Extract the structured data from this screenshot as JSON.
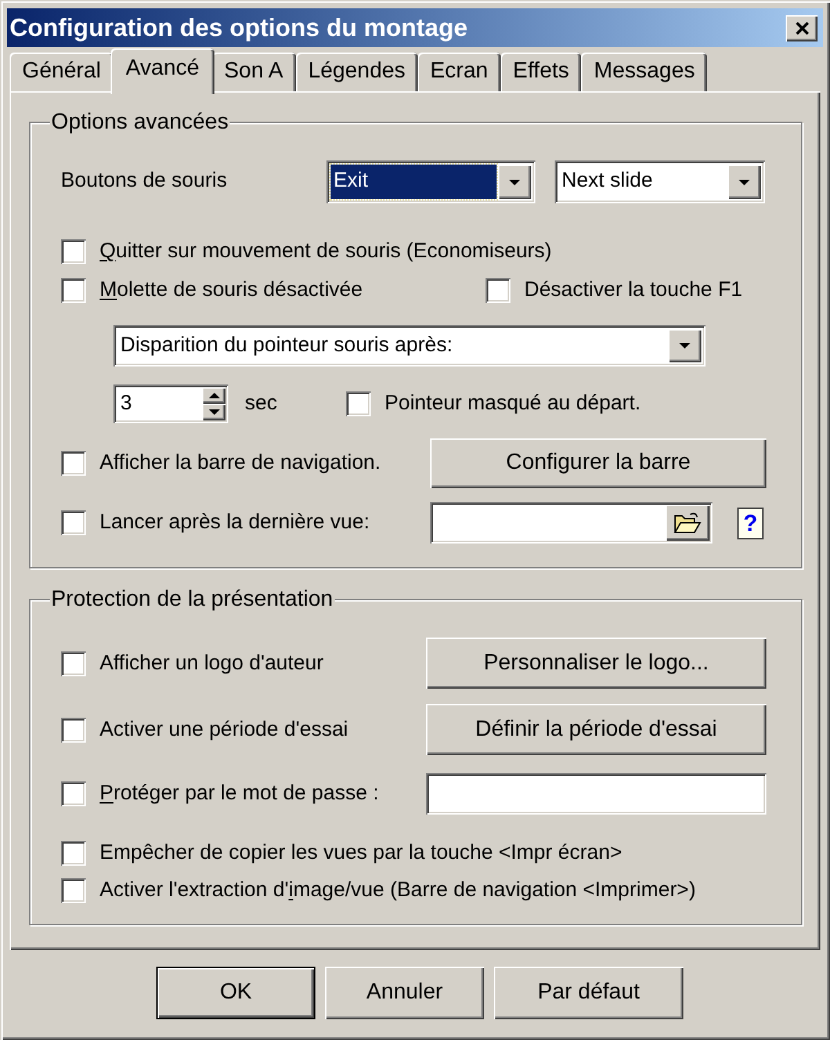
{
  "window": {
    "title": "Configuration des options du montage"
  },
  "tabs": [
    {
      "label": "Général",
      "selected": false
    },
    {
      "label": "Avancé",
      "selected": true
    },
    {
      "label": "Son A",
      "selected": false
    },
    {
      "label": "Légendes",
      "selected": false
    },
    {
      "label": "Ecran",
      "selected": false
    },
    {
      "label": "Effets",
      "selected": false
    },
    {
      "label": "Messages",
      "selected": false
    }
  ],
  "advanced": {
    "legend": "Options avancées",
    "mouse_buttons": {
      "label": "Boutons de souris",
      "combos": [
        {
          "value": "Exit",
          "focused": true
        },
        {
          "value": "Next slide",
          "focused": false
        }
      ]
    },
    "quit_on_mouse_move": {
      "access_key": "Q",
      "label_rest": "uitter sur mouvement de souris (Economiseurs)",
      "checked": false
    },
    "wheel_disabled": {
      "access_key": "M",
      "label_rest": "olette de souris désactivée",
      "checked": false
    },
    "disable_f1": {
      "label": "Désactiver la touche F1",
      "checked": false
    },
    "pointer_hide": {
      "value": "Disparition du pointeur souris après:"
    },
    "delay": {
      "value": "3",
      "unit": "sec"
    },
    "pointer_hidden_at_start": {
      "label": "Pointeur masqué au départ.",
      "checked": false
    },
    "navigation_bar": {
      "label": "Afficher la barre de navigation.",
      "checked": false,
      "button": "Configurer la barre"
    },
    "launch_after_last": {
      "label": "Lancer après la dernière vue:",
      "checked": false,
      "help": "?"
    }
  },
  "protection": {
    "legend": "Protection de la présentation",
    "author_logo": {
      "label": "Afficher un logo d'auteur",
      "checked": false,
      "button": "Personnaliser le logo..."
    },
    "trial_period": {
      "label": "Activer une période d'essai",
      "checked": false,
      "button": "Définir la période d'essai"
    },
    "password": {
      "access_key": "P",
      "label_rest": "rotéger par le mot de passe :",
      "checked": false
    },
    "prevent_print_screen": {
      "label": "Empêcher de copier les vues par la touche <Impr écran>",
      "checked": false
    },
    "image_extraction": {
      "label_start": "Activer l'extraction d'",
      "access_key": "i",
      "label_rest": "mage/vue (Barre de navigation <Imprimer>)",
      "checked": false
    }
  },
  "buttons": [
    {
      "label": "OK",
      "default": true
    },
    {
      "label": "Annuler",
      "default": false
    },
    {
      "label": "Par défaut",
      "default": false
    }
  ]
}
